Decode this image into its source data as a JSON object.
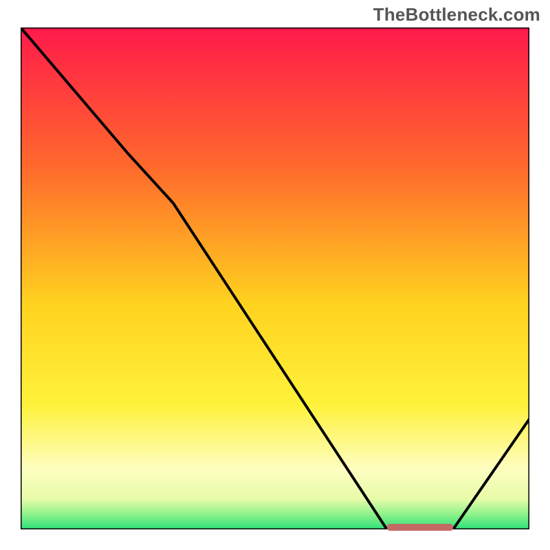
{
  "watermark": "TheBottleneck.com",
  "chart_data": {
    "type": "line",
    "title": "",
    "xlabel": "",
    "ylabel": "",
    "x": [
      0,
      21,
      30,
      72,
      78,
      85,
      100
    ],
    "y": [
      100,
      75,
      65,
      0,
      0,
      0,
      22
    ],
    "xlim": [
      0,
      100
    ],
    "ylim": [
      0,
      100
    ],
    "marker": {
      "x_start": 72,
      "x_end": 85,
      "y": 0
    },
    "gradient_stops": [
      {
        "offset": 0,
        "color": "#ff1a4a"
      },
      {
        "offset": 28,
        "color": "#ff6a2c"
      },
      {
        "offset": 55,
        "color": "#ffd21f"
      },
      {
        "offset": 75,
        "color": "#fff23a"
      },
      {
        "offset": 88,
        "color": "#fdfec0"
      },
      {
        "offset": 94,
        "color": "#e7fca8"
      },
      {
        "offset": 97,
        "color": "#8ef28a"
      },
      {
        "offset": 100,
        "color": "#2de07a"
      }
    ],
    "line_color": "#000000",
    "line_width": 4,
    "border_color": "#000000",
    "border_width": 3
  }
}
